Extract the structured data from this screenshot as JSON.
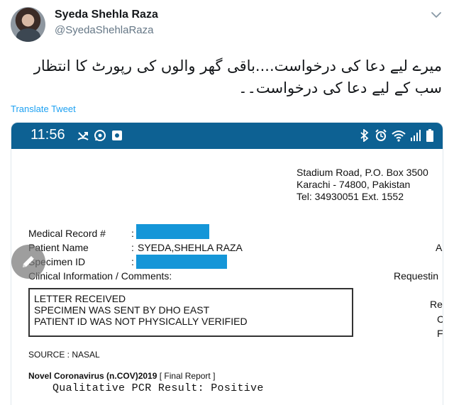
{
  "tweet": {
    "display_name": "Syeda Shehla Raza",
    "handle": "@SyedaShehlaRaza",
    "text_line1": "میرے لیے دعا کی درخواست....باقی گھر والوں کی رپورٹ کا انتظار",
    "text_line2": "سب کے لیے دعا کی درخواست۔۔",
    "translate_label": "Translate Tweet"
  },
  "phone": {
    "time": "11:56",
    "status_bar_color": "#0d6193"
  },
  "report": {
    "address": {
      "line1": "Stadium Road, P.O. Box 3500",
      "line2": "Karachi - 74800, Pakistan",
      "line3": "Tel: 34930051 Ext. 1552"
    },
    "fields": {
      "medical_record_label": "Medical Record #",
      "patient_name_label": "Patient Name",
      "specimen_id_label": "Specimen ID",
      "clinical_info_label": "Clinical Information / Comments:",
      "colon": ":",
      "patient_name_value": "SYEDA,SHEHLA RAZA"
    },
    "cropped_right": {
      "age_frag": "A",
      "requesting_frag": "Requestin",
      "re_frag": "Re",
      "c_frag": "C",
      "f_frag": "F"
    },
    "comments": {
      "line1": "LETTER RECEIVED",
      "line2": "SPECIMEN WAS SENT BY DHO EAST",
      "line3": "PATIENT ID WAS NOT PHYSICALLY VERIFIED"
    },
    "source": "SOURCE : NASAL",
    "test_name": "Novel Coronavirus (n.COV)2019",
    "report_status": "[ Final Report ]",
    "result": "Qualitative PCR Result: Positive",
    "redaction_color": "#1596d8"
  },
  "icons": {
    "more": "chevron-down-icon",
    "edit": "pencil-icon",
    "missed_call": "missed-call-icon",
    "whatsapp": "whatsapp-icon",
    "notification": "notification-icon",
    "bluetooth": "bluetooth-icon",
    "alarm": "alarm-icon",
    "wifi": "wifi-icon",
    "signal": "signal-icon",
    "battery": "battery-icon"
  }
}
